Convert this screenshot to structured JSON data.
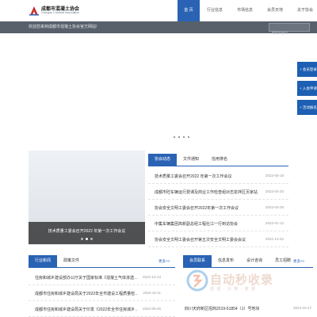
{
  "header": {
    "logo_cn": "成都市混凝土协会",
    "logo_en": "Chengdu Concrete Association",
    "nav": [
      "首 页",
      "行业信息",
      "市场信息",
      "会员天地",
      "关于协会"
    ]
  },
  "welcome": {
    "text": "欢迎您来到成都市混凝土协会官方网站!",
    "search_placeholder": "搜索关键词"
  },
  "side_tabs": [
    "+ 会员登录",
    "+ 入会申请",
    "+ 活动报名"
  ],
  "banner": {
    "caption": "技术质量工委会召开2022 年第一次工作会议"
  },
  "association": {
    "tabs": [
      "协会动态",
      "文件通知",
      "信用排名"
    ],
    "items": [
      {
        "title": "技术质量工委会召开2022 年第一次工作会议",
        "date": "2022-05-18"
      },
      {
        "title": "成都市砼车辆运行费课及商业工作检查组对志泉拌区页家站点进行车…",
        "date": "2022-04-20"
      },
      {
        "title": "协会安全文明工委会召开2022年第一次工作会议",
        "date": "2022-03-28"
      },
      {
        "title": "中集车辆集团高新副总经工程社江一行到访协会",
        "date": "2022-01-12"
      },
      {
        "title": "协会安全文明工委会召开第五次安全文明工委会会议",
        "date": "2021-12-22"
      }
    ]
  },
  "industry": {
    "tabs": [
      "行业新闻",
      "政策文件"
    ],
    "more": "更多>>",
    "items": [
      {
        "title": "住房和城乡建设部办公厅关于国家标准《混凝土气体渗透…",
        "date": "2022-10-13"
      },
      {
        "title": "成都市住房和城乡建设局关于2022年全市建设工程质量检…",
        "date": "2022-10-11"
      },
      {
        "title": "成都市住房和城乡建设局关于印发《2022年全市住房城乡…",
        "date": "2022-05-26"
      }
    ]
  },
  "market": {
    "tabs": [
      "会员联系",
      "信息发布",
      "设计咨询",
      "员工招聘"
    ],
    "more": "更多>>",
    "items": [
      {
        "title": "四川天府新区招商2019-51854（1）号地块",
        "date": "2024-10-17"
      }
    ]
  },
  "watermark": {
    "text": "自动秒收录",
    "sub": "自 动 · 分 类 · 收 录"
  },
  "colors": {
    "primary": "#2a63b4",
    "welcome_bar": "#58606b",
    "side_tab": "#1d5fb3"
  }
}
